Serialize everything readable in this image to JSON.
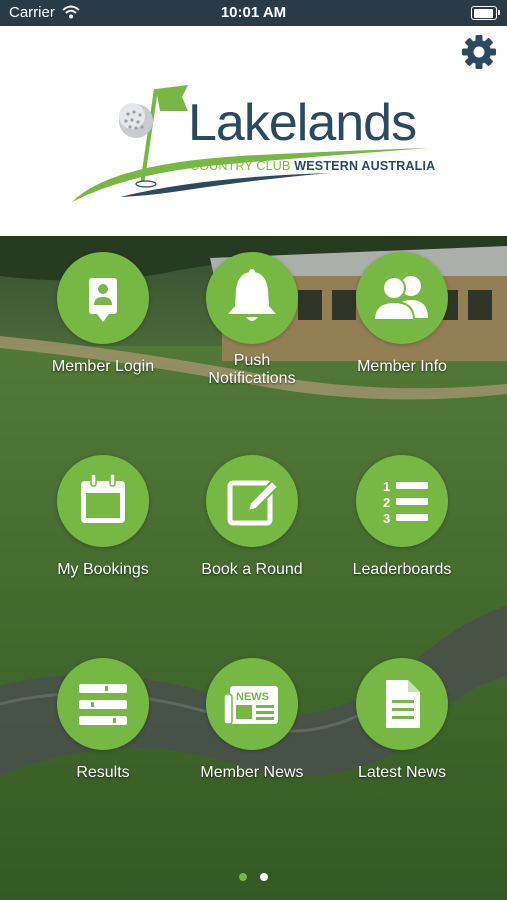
{
  "status": {
    "carrier": "Carrier",
    "time": "10:01 AM",
    "battery_level": 1.0
  },
  "brand": {
    "name": "Lakelands",
    "tagline_green": "COUNTRY CLUB",
    "tagline_dark": "WESTERN AUSTRALIA",
    "colors": {
      "navy": "#2b4a5e",
      "green": "#76b843",
      "header_bar": "#2a3a47"
    }
  },
  "tiles": [
    {
      "label": "Member Login",
      "icon": "member-id-icon"
    },
    {
      "label": "Push\nNotifications",
      "icon": "bell-icon"
    },
    {
      "label": "Member Info",
      "icon": "users-icon"
    },
    {
      "label": "My Bookings",
      "icon": "calendar-icon"
    },
    {
      "label": "Book a Round",
      "icon": "edit-pencil-icon"
    },
    {
      "label": "Leaderboards",
      "icon": "numbered-list-icon"
    },
    {
      "label": "Results",
      "icon": "list-toggles-icon"
    },
    {
      "label": "Member News",
      "icon": "newspaper-icon"
    },
    {
      "label": "Latest News",
      "icon": "document-icon"
    }
  ],
  "newspaper_text": "NEWS",
  "leaderboard_numbers": [
    "1",
    "2",
    "3"
  ],
  "pager": {
    "pages": 2,
    "current": 1,
    "active_color": "#76b843",
    "inactive_color": "#ffffff"
  }
}
